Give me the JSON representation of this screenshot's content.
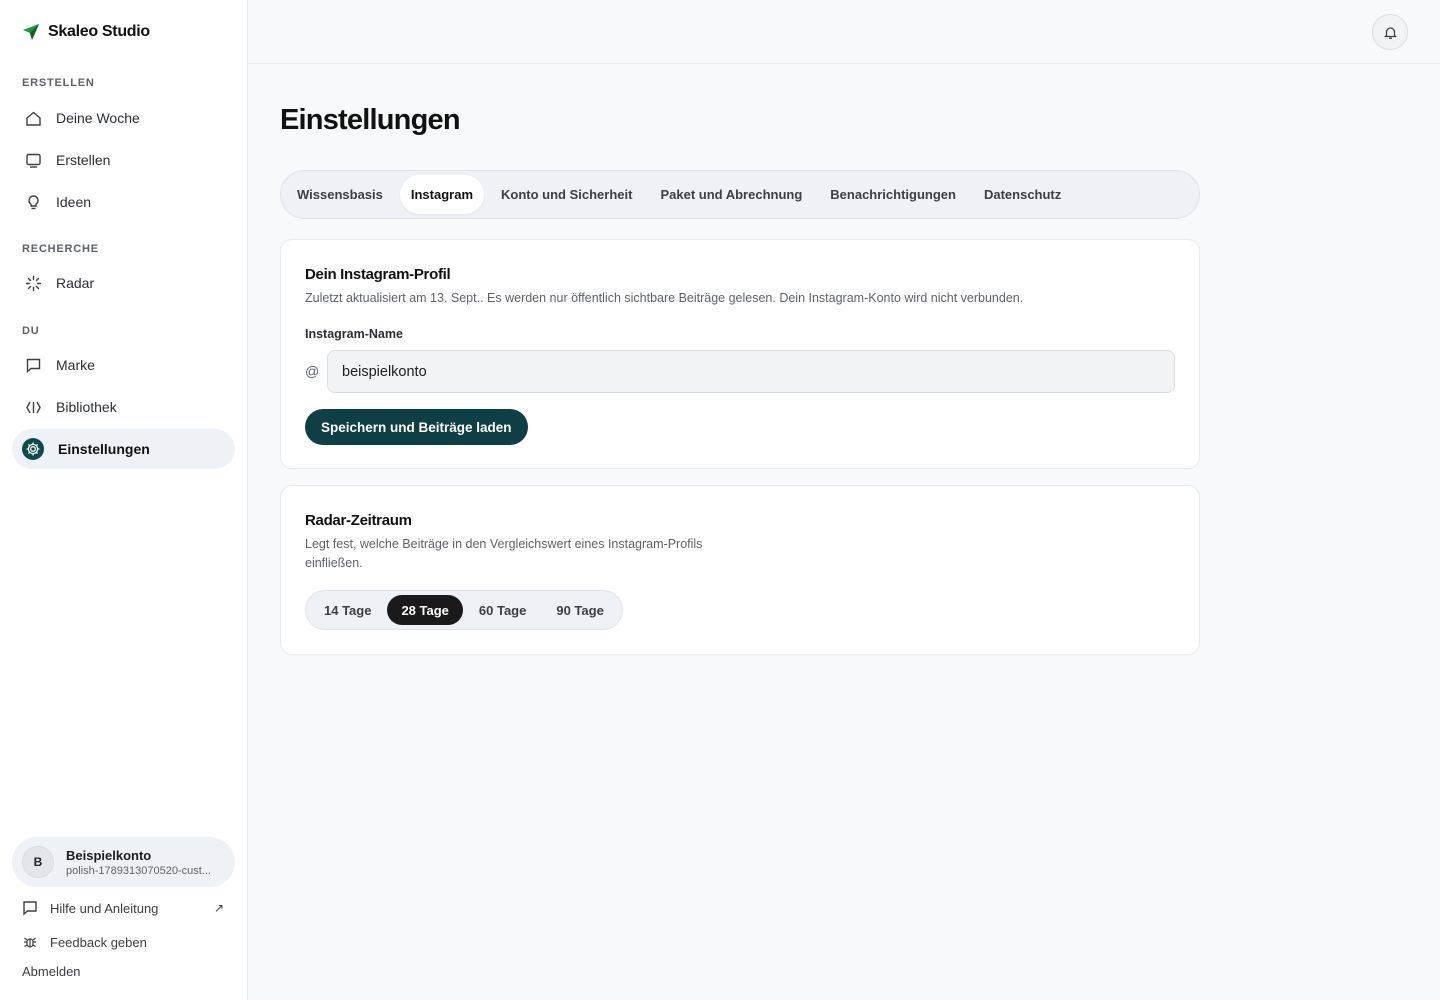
{
  "app": {
    "name": "Skaleo Studio",
    "accent": "#0d3f44",
    "brand_green": "#1a9a3a"
  },
  "sidebar": {
    "sections": [
      {
        "label": "ERSTELLEN",
        "items": [
          {
            "label": "Deine Woche",
            "icon": "home-icon"
          },
          {
            "label": "Erstellen",
            "icon": "monitor-icon"
          },
          {
            "label": "Ideen",
            "icon": "lightbulb-icon"
          }
        ]
      },
      {
        "label": "RECHERCHE",
        "items": [
          {
            "label": "Radar",
            "icon": "radar-icon"
          }
        ]
      },
      {
        "label": "DU",
        "items": [
          {
            "label": "Marke",
            "icon": "chat-icon"
          },
          {
            "label": "Bibliothek",
            "icon": "library-icon"
          },
          {
            "label": "Einstellungen",
            "icon": "gear-icon",
            "active": true
          }
        ]
      }
    ],
    "account": {
      "initial": "B",
      "name": "Beispielkonto",
      "sub": "polish-1789313070520-cust..."
    },
    "footer": {
      "help": "Hilfe und Anleitung",
      "feedback": "Feedback geben",
      "logout": "Abmelden"
    }
  },
  "header": {
    "bell_icon": "bell-icon"
  },
  "main": {
    "title": "Einstellungen",
    "tabs": [
      {
        "label": "Wissensbasis"
      },
      {
        "label": "Instagram",
        "active": true
      },
      {
        "label": "Konto und Sicherheit"
      },
      {
        "label": "Paket und Abrechnung"
      },
      {
        "label": "Benachrichtigungen"
      },
      {
        "label": "Datenschutz"
      }
    ],
    "profile_card": {
      "title": "Dein Instagram-Profil",
      "description": "Zuletzt aktualisiert am 13. Sept.. Es werden nur öffentlich sichtbare Beiträge gelesen. Dein Instagram-Konto wird nicht verbunden.",
      "field_label": "Instagram-Name",
      "at_symbol": "@",
      "field_value": "beispielkonto",
      "button": "Speichern und Beiträge laden"
    },
    "radar_card": {
      "title": "Radar-Zeitraum",
      "description_line1": "Legt fest, welche Beiträge in den Vergleichswert eines Instagram-Profils",
      "description_line2": "einfließen.",
      "options": [
        "14 Tage",
        "28 Tage",
        "60 Tage",
        "90 Tage"
      ],
      "selected": "28 Tage"
    }
  }
}
